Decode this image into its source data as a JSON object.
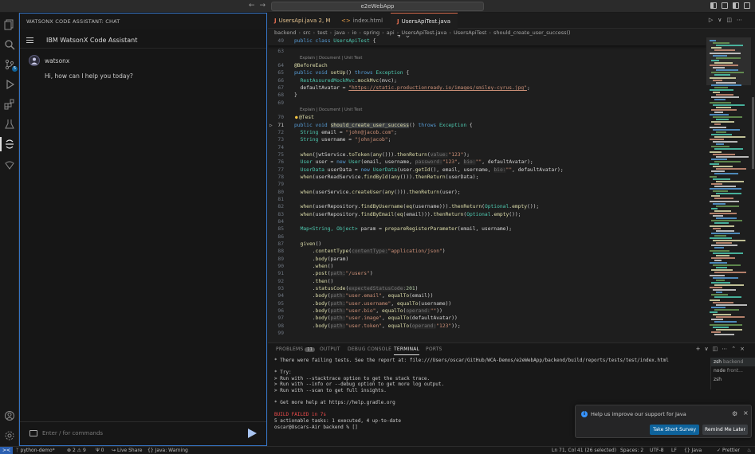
{
  "window": {
    "search_text": "e2eWebApp"
  },
  "activity": {
    "scm_badge": "5"
  },
  "chat": {
    "panel_header": "WATSONX CODE ASSISTANT: CHAT",
    "title": "IBM WatsonX Code Assistant",
    "sender": "watsonx",
    "greeting": "Hi, how can I help you today?",
    "input_placeholder": "Enter / for commands"
  },
  "tabs": [
    {
      "name": "UsersApi.java",
      "suffix": "2, M",
      "kind": "java"
    },
    {
      "name": "index.html",
      "suffix": "",
      "kind": "html"
    },
    {
      "name": "UsersApiTest.java",
      "suffix": "7",
      "kind": "java"
    }
  ],
  "breadcrumbs": [
    "backend",
    "src",
    "test",
    "java",
    "io",
    "spring",
    "api",
    "UsersApiTest.java",
    "UsersApiTest",
    "should_create_user_success()"
  ],
  "editor": {
    "sticky_line_number": "49",
    "sticky_code": "public class UsersApiTest {",
    "codelens": "Explain | Document | Unit Test",
    "lines": {
      "l63": "63",
      "l64": "64",
      "l65": "65",
      "l66": "66",
      "l67": "67",
      "l68": "68",
      "l69": "69",
      "l70": "70",
      "l71": "71",
      "l72": "72",
      "l73": "73",
      "l74": "74",
      "l75": "75",
      "l76": "76",
      "l77": "77",
      "l78": "78",
      "l79": "79",
      "l80": "80",
      "l81": "81",
      "l82": "82",
      "l83": "83",
      "l84": "84",
      "l85": "85",
      "l86": "86",
      "l87": "87",
      "l88": "88",
      "l89": "89",
      "l90": "90",
      "l91": "91",
      "l92": "92",
      "l93": "93",
      "l94": "94",
      "l95": "95",
      "l96": "96",
      "l97": "97",
      "l98": "98",
      "l99": "99"
    },
    "t": {
      "before_each": "@BeforeEach",
      "public": "public",
      "void": "void",
      "setup": "setUp",
      "throws": "throws",
      "exception": "Exception",
      "ra": "RestAssuredMockMvc",
      "mockmvc": "mockMvc",
      "mvc": "mvc",
      "default_avatar": "defaultAvatar",
      "avatar_url": "\"https://static.productionready.io/images/smiley-cyrus.jpg\"",
      "test_ann": "@Test",
      "test_method": "should_create_user_success",
      "string": "String",
      "email": "email",
      "email_val": "\"john@jacob.com\"",
      "username": "username",
      "username_val": "\"johnjacob\"",
      "when": "when",
      "jwt_service": "jwtService",
      "to_token": "toToken",
      "any": "any",
      "then_return": "thenReturn",
      "value_hint": "value:",
      "token_val": "\"123\"",
      "user_type": "User",
      "user_var": "user",
      "new": "new",
      "password_hint": "password:",
      "bio_hint": "bio:",
      "empty_str": "\"\"",
      "user_data_type": "UserData",
      "user_data_var": "userData",
      "get_id": "getId",
      "user_read_service": "userReadService",
      "find_by_id": "findById",
      "user_service": "userService",
      "create_user": "createUser",
      "user_repo": "userRepository",
      "find_by_username": "findByUsername",
      "find_by_email": "findByEmail",
      "eq": "eq",
      "optional": "Optional",
      "empty": "empty",
      "map_type": "Map<String, Object>",
      "param": "param",
      "prepare": "prepareRegisterParameter",
      "given": "given",
      "content_type": "contentType",
      "content_type_hint": "contentType:",
      "app_json": "\"application/json\"",
      "body": "body",
      "post": "post",
      "path_hint": "path:",
      "users_path": "\"/users\"",
      "then": "then",
      "status_code": "statusCode",
      "expected_hint": "expectedStatusCode:",
      "code_201": "201",
      "user_email": "\"user.email\"",
      "equal_to": "equalTo",
      "user_username": "\"user.username\"",
      "user_bio": "\"user.bio\"",
      "operand_hint": "operand:",
      "user_image": "\"user.image\"",
      "user_token": "\"user.token\""
    }
  },
  "panel": {
    "tabs": [
      "PROBLEMS",
      "OUTPUT",
      "DEBUG CONSOLE",
      "TERMINAL",
      "PORTS"
    ],
    "problems_count": "11",
    "terminal_lines": [
      "* There were failing tests. See the report at: file:///Users/oscar/GitHub/WCA-Demos/e2eWebApp/backend/build/reports/tests/test/index.html",
      "",
      "* Try:",
      "> Run with --stacktrace option to get the stack trace.",
      "> Run with --info or --debug option to get more log output.",
      "> Run with --scan to get full insights.",
      "",
      "* Get more help at https://help.gradle.org",
      "",
      "BUILD FAILED in 7s",
      "5 actionable tasks: 1 executed, 4 up-to-date",
      "oscar@Oscars-Air backend % []"
    ],
    "terminals": [
      {
        "name": "zsh",
        "detail": "backend"
      },
      {
        "name": "node",
        "detail": "front..."
      },
      {
        "name": "zsh",
        "detail": ""
      }
    ]
  },
  "notification": {
    "message": "Help us improve our support for Java",
    "primary": "Take Short Survey",
    "secondary": "Remind Me Later"
  },
  "statusbar": {
    "branch": "python-demo*",
    "errors": "2",
    "warnings": "9",
    "ports": "0",
    "live_share": "Live Share",
    "java": "Java: Warning",
    "cursor": "Ln 71, Col 41 (26 selected)",
    "spaces": "Spaces: 2",
    "encoding": "UTF-8",
    "eol": "LF",
    "language": "Java",
    "prettier": "Prettier"
  },
  "colors": {
    "accent": "#3573c2",
    "primary_button": "#0e639c",
    "error": "#f14c4c",
    "active_tab_border": "#d4694b"
  }
}
